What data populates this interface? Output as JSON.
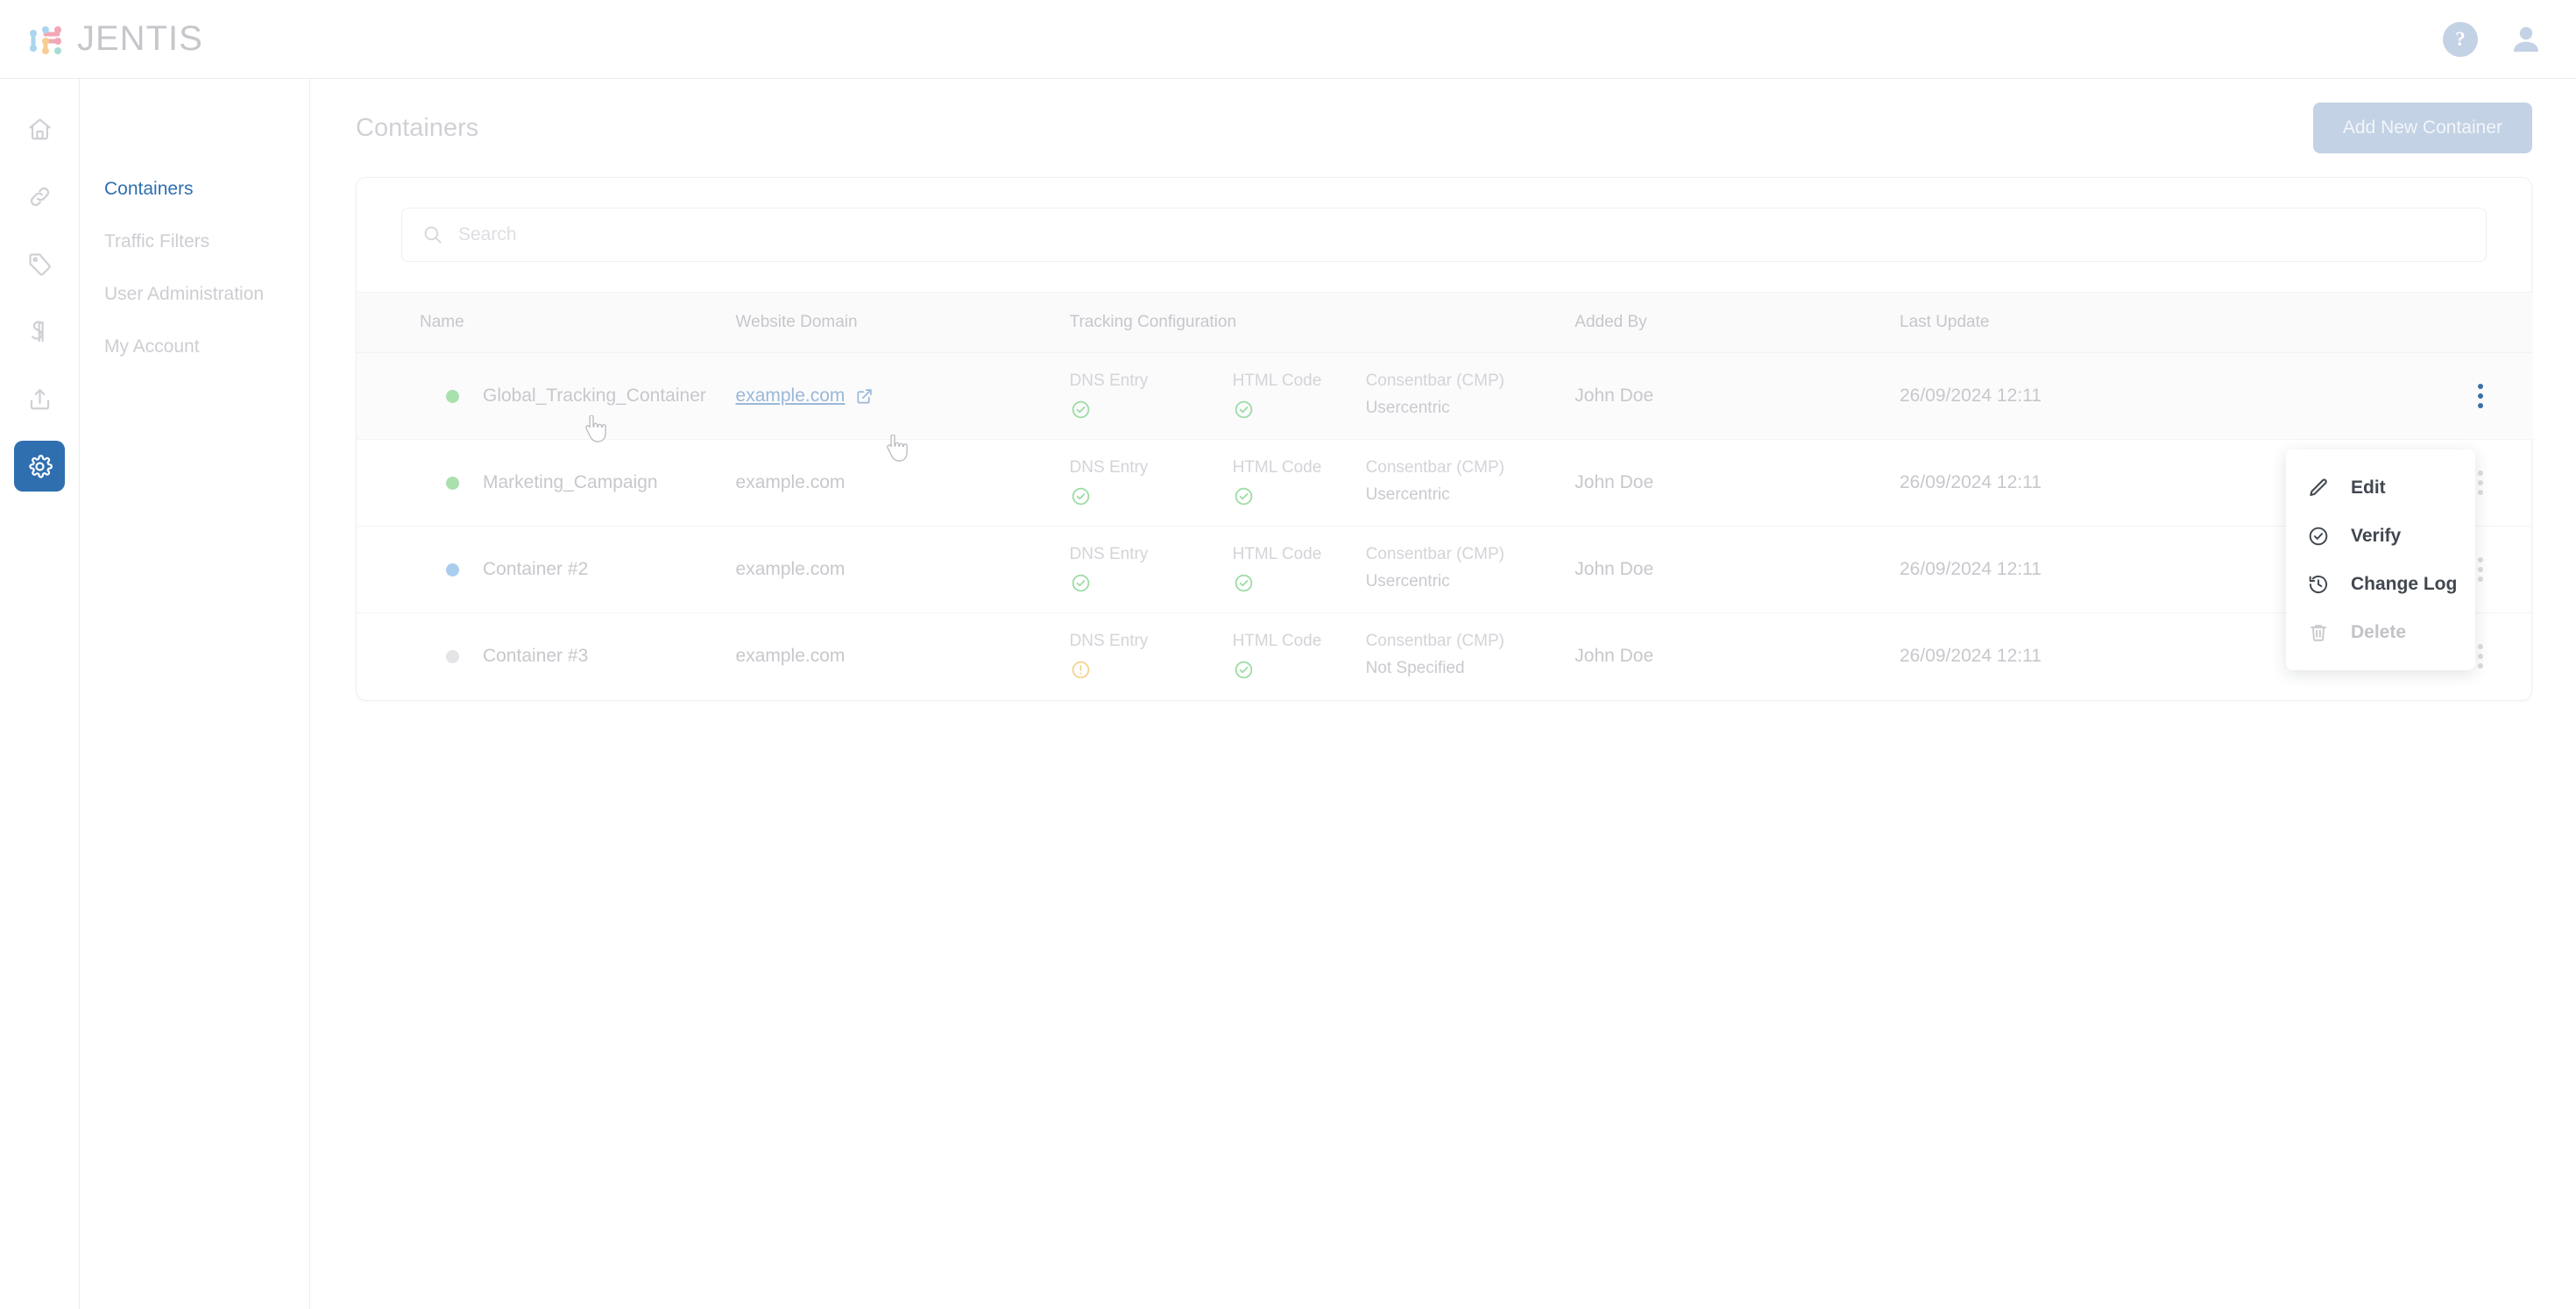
{
  "app": {
    "brand": "JENTIS",
    "logo_colors": [
      "#a9d5ef",
      "#f2a7b6",
      "#f6cd92",
      "#a7dcd3"
    ],
    "accent": "#2f6fb0"
  },
  "topbar": {
    "help_glyph": "?",
    "help_name": "help-icon",
    "avatar_name": "user-avatar-icon"
  },
  "rail": {
    "items": [
      {
        "icon": "home-icon",
        "active": false
      },
      {
        "icon": "link-icon",
        "active": false
      },
      {
        "icon": "tag-icon",
        "active": false
      },
      {
        "icon": "paragraph-icon",
        "active": false
      },
      {
        "icon": "upload-icon",
        "active": false
      },
      {
        "icon": "gear-icon",
        "active": true
      }
    ]
  },
  "subnav": {
    "items": [
      {
        "label": "Containers",
        "active": true
      },
      {
        "label": "Traffic Filters",
        "active": false
      },
      {
        "label": "User Administration",
        "active": false
      },
      {
        "label": "My Account",
        "active": false
      }
    ]
  },
  "page": {
    "title": "Containers",
    "add_button": "Add New Container"
  },
  "search": {
    "value": "",
    "placeholder": "Search"
  },
  "table": {
    "columns": [
      "Name",
      "Website Domain",
      "Tracking Configuration",
      "Added By",
      "Last Update"
    ],
    "track_labels": {
      "dns": "DNS Entry",
      "html": "HTML Code",
      "cmp": "Consentbar (CMP)"
    },
    "rows": [
      {
        "name": "Global_Tracking_Container",
        "status": "green",
        "domain": "example.com",
        "domain_is_link": true,
        "dns_status": "ok",
        "html_status": "ok",
        "cmp_value": "Usercentric",
        "added_by": "John Doe",
        "last_update": "26/09/2024 12:11",
        "kebab_active": true
      },
      {
        "name": "Marketing_Campaign",
        "status": "green",
        "domain": "example.com",
        "domain_is_link": false,
        "dns_status": "ok",
        "html_status": "ok",
        "cmp_value": "Usercentric",
        "added_by": "John Doe",
        "last_update": "26/09/2024 12:11",
        "kebab_active": false
      },
      {
        "name": "Container #2",
        "status": "blue",
        "domain": "example.com",
        "domain_is_link": false,
        "dns_status": "ok",
        "html_status": "ok",
        "cmp_value": "Usercentric",
        "added_by": "John Doe",
        "last_update": "26/09/2024 12:11",
        "kebab_active": false
      },
      {
        "name": "Container #3",
        "status": "gray",
        "domain": "example.com",
        "domain_is_link": false,
        "dns_status": "warn",
        "html_status": "ok",
        "cmp_value": "Not Specified",
        "added_by": "John Doe",
        "last_update": "26/09/2024 12:11",
        "kebab_active": false
      }
    ]
  },
  "context_menu": {
    "items": [
      {
        "label": "Edit",
        "icon": "pencil-icon",
        "disabled": false
      },
      {
        "label": "Verify",
        "icon": "check-circle-icon",
        "disabled": false
      },
      {
        "label": "Change Log",
        "icon": "history-icon",
        "disabled": false
      },
      {
        "label": "Delete",
        "icon": "trash-icon",
        "disabled": true
      }
    ]
  }
}
